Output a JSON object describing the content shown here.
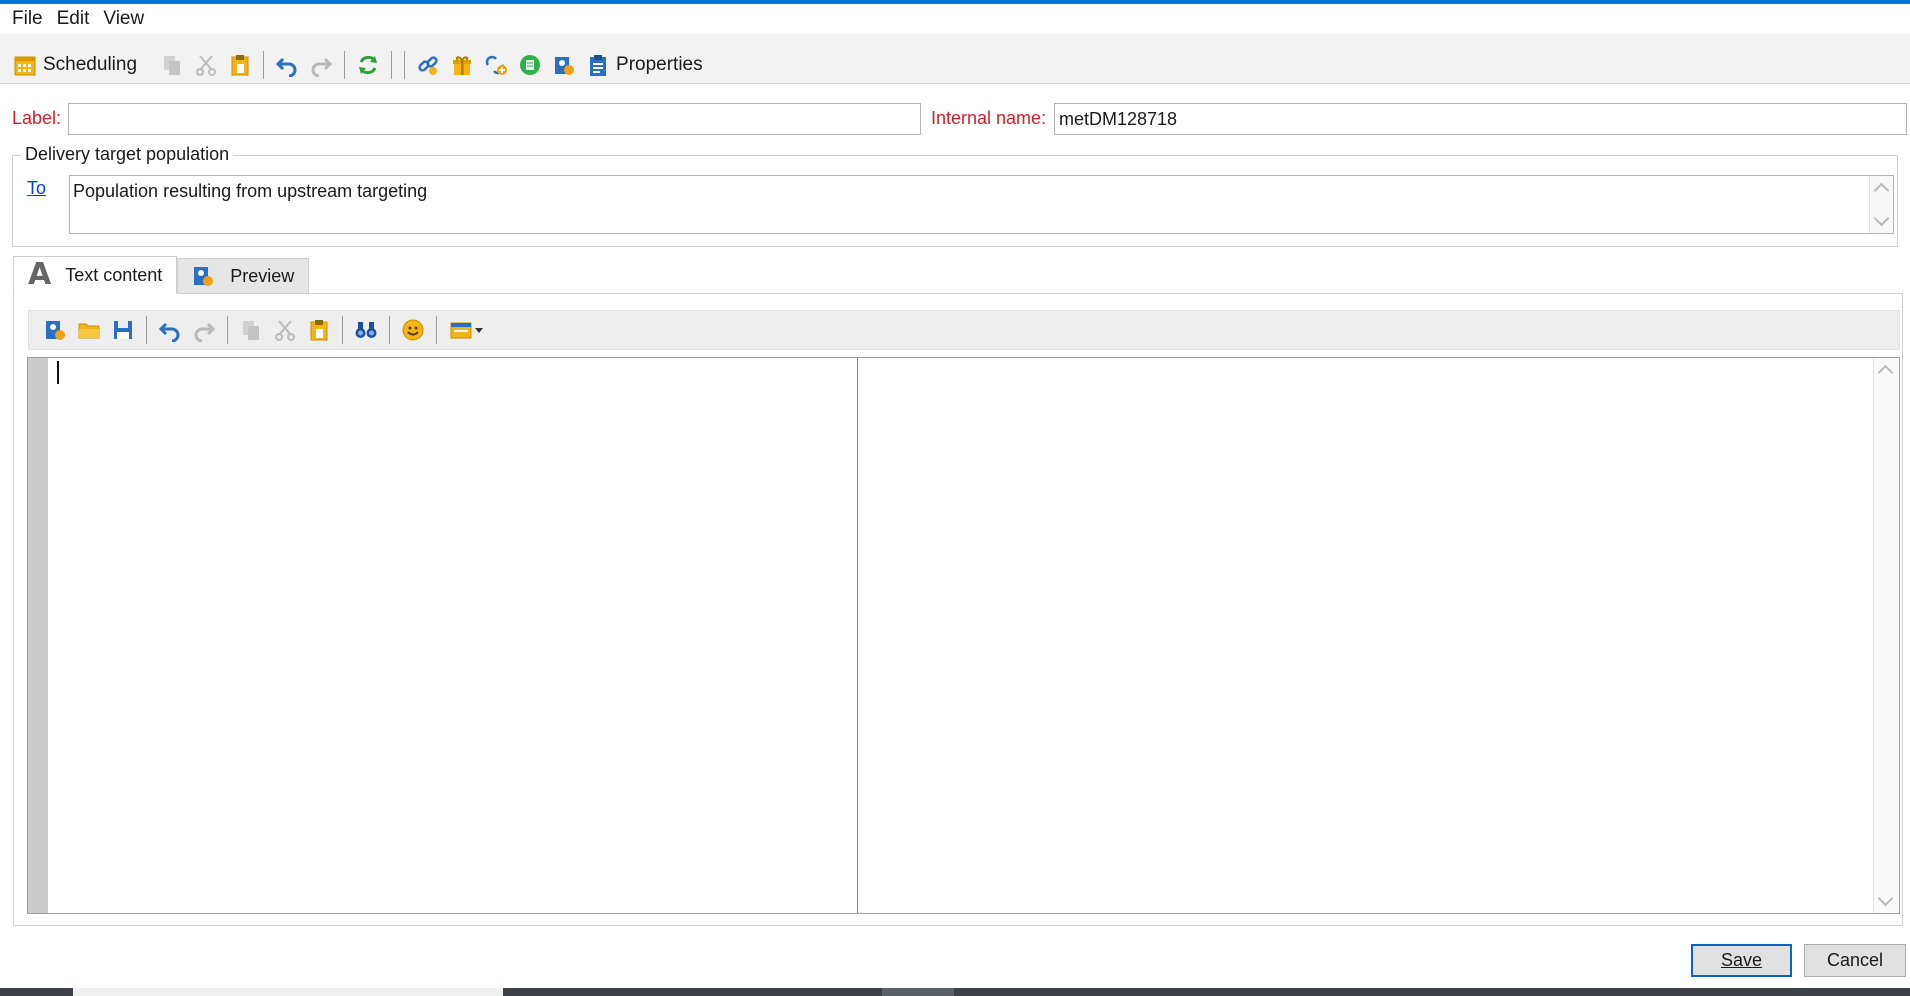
{
  "menu": {
    "file": "File",
    "edit": "Edit",
    "view": "View"
  },
  "toolbar": {
    "scheduling_label": "Scheduling",
    "properties_label": "Properties",
    "icons": [
      "calendar-icon",
      "copy-icon",
      "cut-icon",
      "paste-icon",
      "undo-icon",
      "redo-icon",
      "refresh-icon",
      "link-icon",
      "gift-icon",
      "link-add-icon",
      "green-circle-icon",
      "user-card-icon",
      "clipboard-icon"
    ]
  },
  "form": {
    "label_caption": "Label:",
    "label_value": "",
    "internal_name_caption": "Internal name:",
    "internal_name_value": "metDM128718"
  },
  "target": {
    "group_title": "Delivery target population",
    "to_link": "To",
    "to_text": "Population resulting from upstream targeting"
  },
  "tabs": {
    "text_content": "Text content",
    "preview": "Preview"
  },
  "editor_toolbar": {
    "icons": [
      "insert-personalization-icon",
      "open-folder-icon",
      "save-icon",
      "undo-icon",
      "redo-icon",
      "copy-icon",
      "cut-icon",
      "paste-icon",
      "find-binoculars-icon",
      "emoji-icon",
      "insert-block-dropdown-icon"
    ]
  },
  "buttons": {
    "save": "Save",
    "cancel": "Cancel"
  },
  "colors": {
    "accent": "#0a74d4",
    "required_label": "#d0202a",
    "link": "#0a3fd6"
  }
}
